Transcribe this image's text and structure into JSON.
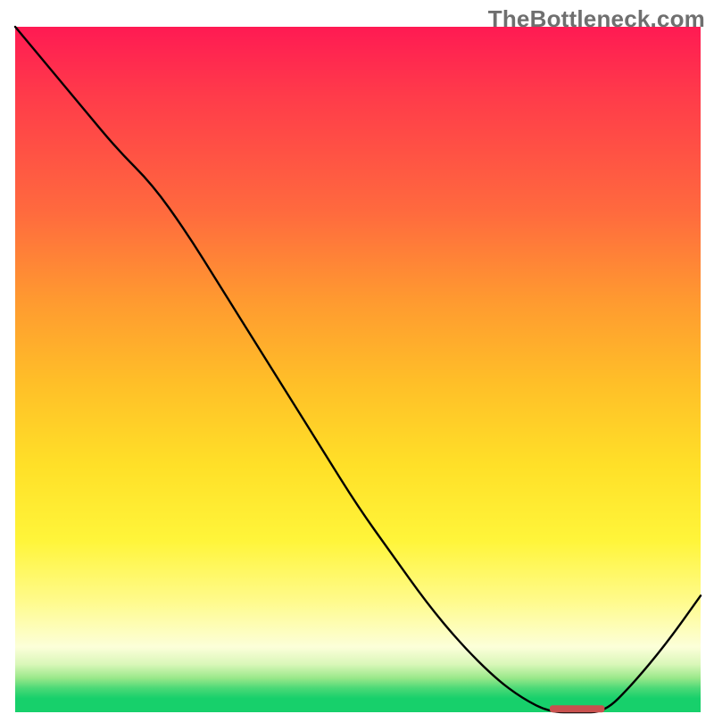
{
  "watermark": "TheBottleneck.com",
  "chart_data": {
    "type": "line",
    "title": "",
    "xlabel": "",
    "ylabel": "",
    "xlim": [
      0,
      1
    ],
    "ylim": [
      0,
      1
    ],
    "grid": false,
    "legend": false,
    "series": [
      {
        "name": "bottleneck-curve",
        "x": [
          0.0,
          0.05,
          0.1,
          0.15,
          0.2,
          0.25,
          0.3,
          0.35,
          0.4,
          0.45,
          0.5,
          0.55,
          0.6,
          0.65,
          0.7,
          0.74,
          0.78,
          0.82,
          0.86,
          0.9,
          0.95,
          1.0
        ],
        "y": [
          1.0,
          0.94,
          0.88,
          0.82,
          0.77,
          0.7,
          0.62,
          0.54,
          0.46,
          0.38,
          0.3,
          0.23,
          0.16,
          0.1,
          0.05,
          0.02,
          0.0,
          0.0,
          0.0,
          0.04,
          0.1,
          0.17
        ]
      }
    ],
    "annotations": [
      {
        "name": "valley-marker",
        "x_start": 0.78,
        "x_end": 0.86,
        "y": 0.005,
        "color": "#c9514e"
      }
    ],
    "background_gradient": {
      "top": "#ff1a53",
      "mid": "#ffe028",
      "bottom": "#17d06b"
    }
  }
}
